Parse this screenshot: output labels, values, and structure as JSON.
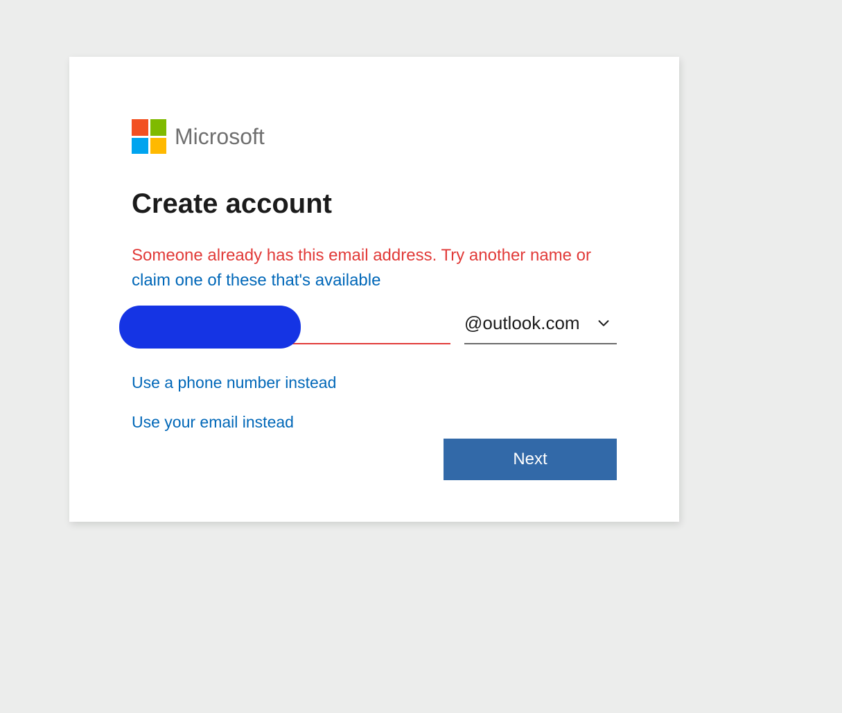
{
  "brand": {
    "name": "Microsoft"
  },
  "page": {
    "title": "Create account"
  },
  "error": {
    "prefix": "Someone already has this email address. Try another name or ",
    "link": "claim one of these that's available"
  },
  "email": {
    "username_value": "",
    "domain_selected": "@outlook.com"
  },
  "links": {
    "use_phone": "Use a phone number instead",
    "use_email": "Use your email instead"
  },
  "buttons": {
    "next": "Next"
  }
}
